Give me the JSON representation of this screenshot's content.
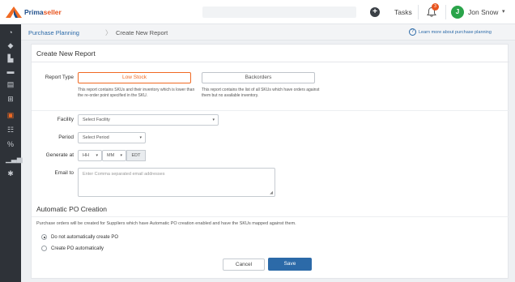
{
  "app": {
    "brand_prefix": "Prima",
    "brand_suffix": "seller"
  },
  "header": {
    "add_icon": "+",
    "tasks_label": "Tasks",
    "notification_count": "3",
    "avatar_initial": "J",
    "user_name": "Jon Snow",
    "user_caret": "▾"
  },
  "breadcrumb": {
    "parent": "Purchase Planning",
    "separator": "〉",
    "current": "Create New Report",
    "help_icon": "?",
    "help_link": "Learn more about purchase planning"
  },
  "sidebar": {
    "icons": [
      "dashboard-icon",
      "tag-icon",
      "cart-icon",
      "card-icon",
      "catalog-icon",
      "inventory-icon",
      "reports-icon",
      "users-icon",
      "percent-icon",
      "chart-icon",
      "settings-icon"
    ]
  },
  "form": {
    "title": "Create New Report",
    "report_type_label": "Report Type",
    "report_types": [
      {
        "label": "Low Stock",
        "selected": true,
        "description": "This report contains SKUs and their inventory which is lower than the re-order point specified in the SKU."
      },
      {
        "label": "Backorders",
        "selected": false,
        "description": "This report contains the list of all SKUs which have orders against them but no available inventory."
      }
    ],
    "facility_label": "Facility",
    "facility_value": "Select Facility",
    "period_label": "Period",
    "period_value": "Select Period",
    "generate_label": "Generate at",
    "hour_value": "HH",
    "minute_value": "MM",
    "timezone": "EDT",
    "email_label": "Email to",
    "email_placeholder": "Enter Comma separated email addresses"
  },
  "auto_po": {
    "title": "Automatic PO Creation",
    "description": "Purchase orders will be created for Suppliers which have Automatic PO creation enabled and have the SKUs mapped against them.",
    "options": [
      {
        "label": "Do not automatically create PO",
        "checked": true
      },
      {
        "label": "Create PO automatically",
        "checked": false
      }
    ]
  },
  "actions": {
    "cancel_label": "Cancel",
    "save_label": "Save"
  },
  "colors": {
    "accent": "#f06a23",
    "primary": "#2c6aa8",
    "sidebar": "#2e3238"
  }
}
